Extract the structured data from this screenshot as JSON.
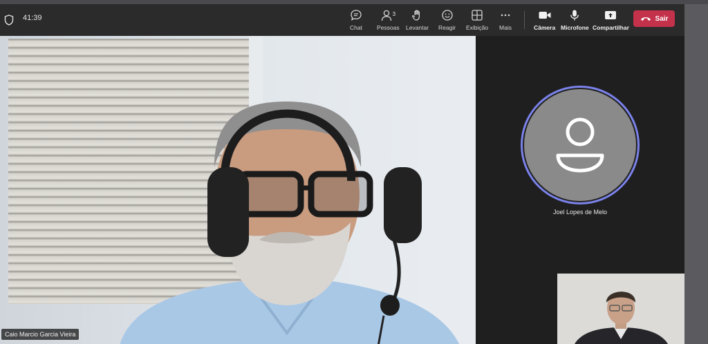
{
  "meeting": {
    "timer": "41:39"
  },
  "toolbar": {
    "chat": "Chat",
    "people": "Pessoas",
    "people_count": "3",
    "raise": "Levantar",
    "react": "Reagir",
    "view": "Exibição",
    "more": "Mais",
    "camera": "Câmera",
    "mic": "Microfone",
    "share": "Compartilhar",
    "leave": "Sair"
  },
  "participants": {
    "main_speaker": "Caio Marcio Garcia Vieira",
    "avatar_participant": "Joel Lopes de Melo"
  },
  "colors": {
    "leave_button": "#c4314b",
    "avatar_ring": "#7b83eb",
    "toolbar_bg": "#2b2b2b"
  }
}
